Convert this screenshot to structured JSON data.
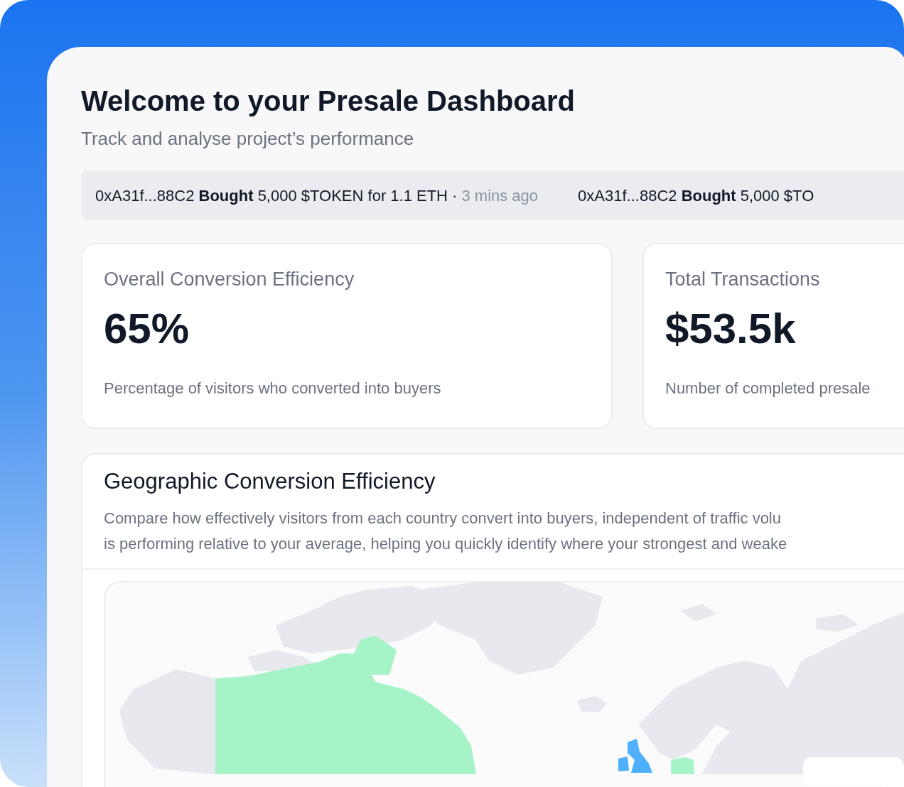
{
  "header": {
    "title": "Welcome to your Presale Dashboard",
    "subtitle": "Track and analyse project’s performance"
  },
  "ticker": [
    {
      "text": "0xA31f...88C2 **Bought** 5,000 $TOKEN for 1.1 ETH ·",
      "time": "3 mins ago"
    },
    {
      "text": "0xA31f...88C2 **Bought** 5,000 $TO"
    }
  ],
  "stats": [
    {
      "label": "Overall Conversion Efficiency",
      "value": "65%",
      "description": "Percentage of visitors who converted into buyers"
    },
    {
      "label": "Total Transactions",
      "value": "$53.5k",
      "description": "Number of completed presale"
    }
  ],
  "geo": {
    "title": "Geographic Conversion Efficiency",
    "description": [
      "Compare how effectively visitors from each country convert into buyers, independent of traffic volu",
      "is performing relative to your average, helping you quickly identify where your strongest and weake"
    ]
  }
}
